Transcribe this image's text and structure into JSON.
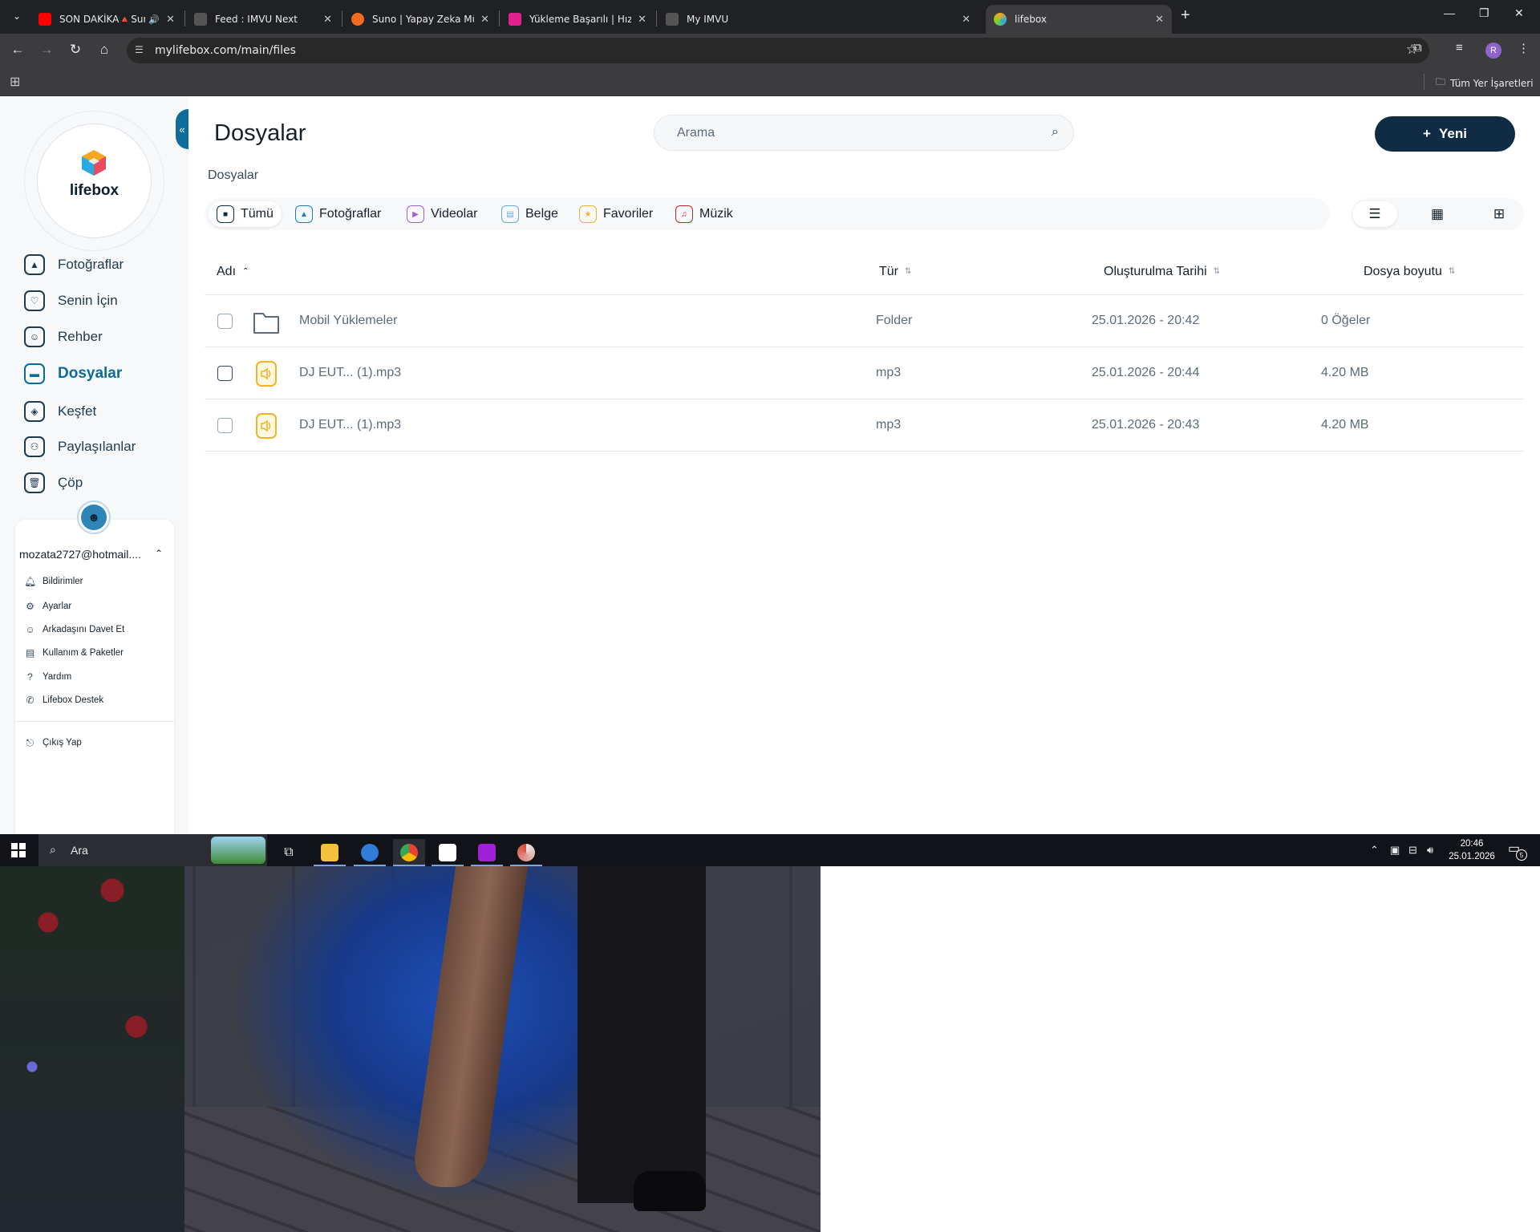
{
  "browser": {
    "tabs": [
      {
        "title": "SON DAKİKA🔺Suriye'de M",
        "color": "#ff0000"
      },
      {
        "title": "Feed : IMVU Next",
        "color": "#e8eaed"
      },
      {
        "title": "Suno | Yapay Zeka Müziği",
        "color": "#f26b1d"
      },
      {
        "title": "Yükleme Başarılı | HızlıResim",
        "color": "#e0218a"
      },
      {
        "title": "My IMVU",
        "color": "#e8eaed"
      },
      {
        "title": "lifebox",
        "color": "#27a9e1"
      }
    ],
    "url": "mylifebox.com/main/files",
    "bookmarks_all": "Tüm Yer İşaretleri",
    "profile_initial": "R"
  },
  "sidebar": {
    "logo": "lifebox",
    "nav": [
      {
        "label": "Fotoğraflar",
        "icon": "image-icon"
      },
      {
        "label": "Senin İçin",
        "icon": "heart-icon"
      },
      {
        "label": "Rehber",
        "icon": "contacts-icon"
      },
      {
        "label": "Dosyalar",
        "icon": "folder-icon"
      },
      {
        "label": "Keşfet",
        "icon": "compass-icon"
      },
      {
        "label": "Paylaşılanlar",
        "icon": "shared-icon"
      },
      {
        "label": "Çöp",
        "icon": "trash-icon"
      }
    ],
    "user": {
      "email": "mozata2727@hotmail....",
      "menu": [
        {
          "label": "Bildirimler",
          "icon": "bell-icon"
        },
        {
          "label": "Ayarlar",
          "icon": "settings-icon"
        },
        {
          "label": "Arkadaşını Davet Et",
          "icon": "invite-icon"
        },
        {
          "label": "Kullanım & Paketler",
          "icon": "usage-icon"
        },
        {
          "label": "Yardım",
          "icon": "help-icon"
        },
        {
          "label": "Lifebox Destek",
          "icon": "phone-icon"
        }
      ],
      "logout": "Çıkış Yap"
    }
  },
  "main": {
    "title": "Dosyalar",
    "search_placeholder": "Arama",
    "new_button": "Yeni",
    "breadcrumb": "Dosyalar",
    "filters": [
      {
        "label": "Tümü",
        "color": "#0f2c44"
      },
      {
        "label": "Fotoğraflar",
        "color": "#1b7fb0"
      },
      {
        "label": "Videolar",
        "color": "#a35fd6"
      },
      {
        "label": "Belge",
        "color": "#6aa8d8"
      },
      {
        "label": "Favoriler",
        "color": "#f0b429"
      },
      {
        "label": "Müzik",
        "color": "#c1272d"
      }
    ],
    "columns": {
      "name": "Adı",
      "type": "Tür",
      "date": "Oluşturulma Tarihi",
      "size": "Dosya boyutu"
    },
    "rows": [
      {
        "name": "Mobil Yüklemeler",
        "type": "Folder",
        "date": "25.01.2026 - 20:42",
        "size": "0 Öğeler",
        "kind": "folder"
      },
      {
        "name": "DJ EUT... (1).mp3",
        "type": "mp3",
        "date": "25.01.2026 - 20:44",
        "size": "4.20 MB",
        "kind": "audio"
      },
      {
        "name": "DJ EUT... (1).mp3",
        "type": "mp3",
        "date": "25.01.2026 - 20:43",
        "size": "4.20 MB",
        "kind": "audio"
      }
    ]
  },
  "taskbar": {
    "search_text": "Ara",
    "time": "20:46",
    "date": "25.01.2026",
    "notification_count": "5"
  },
  "colors": {
    "brand_dark": "#0f2c44",
    "brand_blue": "#0e6a96",
    "audio_yellow": "#f0b429"
  }
}
